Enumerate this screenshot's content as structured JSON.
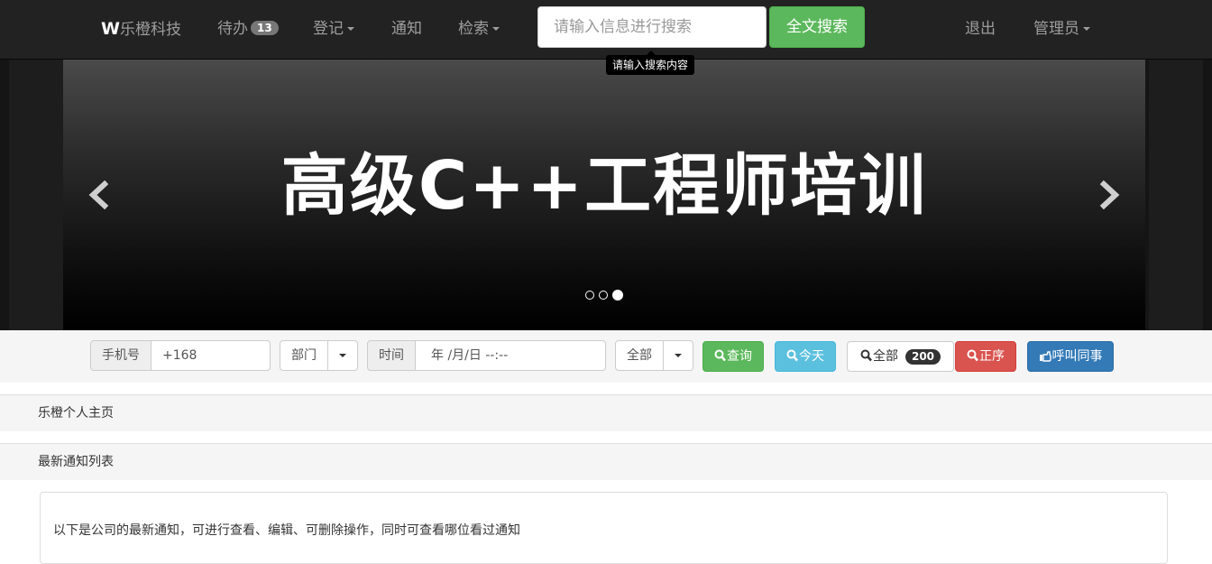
{
  "navbar": {
    "brand_letter": "W",
    "brand_text": "乐橙科技",
    "todo_label": "待办",
    "todo_count": "13",
    "register_label": "登记",
    "notice_label": "通知",
    "search_menu_label": "检索",
    "search_placeholder": "请输入信息进行搜索",
    "search_button": "全文搜索",
    "search_tooltip": "请输入搜索内容",
    "logout_label": "退出",
    "admin_label": "管理员"
  },
  "carousel": {
    "slide_title": "高级C++工程师培训",
    "slide_count": 3,
    "active_index": 2
  },
  "filter": {
    "phone_label": "手机号",
    "phone_value": "+168",
    "dept_label": "部门",
    "time_label": "时间",
    "time_value": "年 /月/日 --:--",
    "scope_label": "全部",
    "query_button": "查询",
    "today_button": "今天",
    "all_button": "全部",
    "all_count": "200",
    "sort_button": "正序",
    "call_button": "呼叫同事"
  },
  "sections": {
    "home_title": "乐橙个人主页",
    "notice_list_title": "最新通知列表",
    "notice_intro": "以下是公司的最新通知，可进行查看、编辑、可删除操作，同时可查看哪位看过通知"
  },
  "colors": {
    "navbar_bg": "#222222",
    "success": "#5cb85c",
    "info": "#5bc0de",
    "danger": "#d9534f",
    "primary": "#337ab7"
  }
}
